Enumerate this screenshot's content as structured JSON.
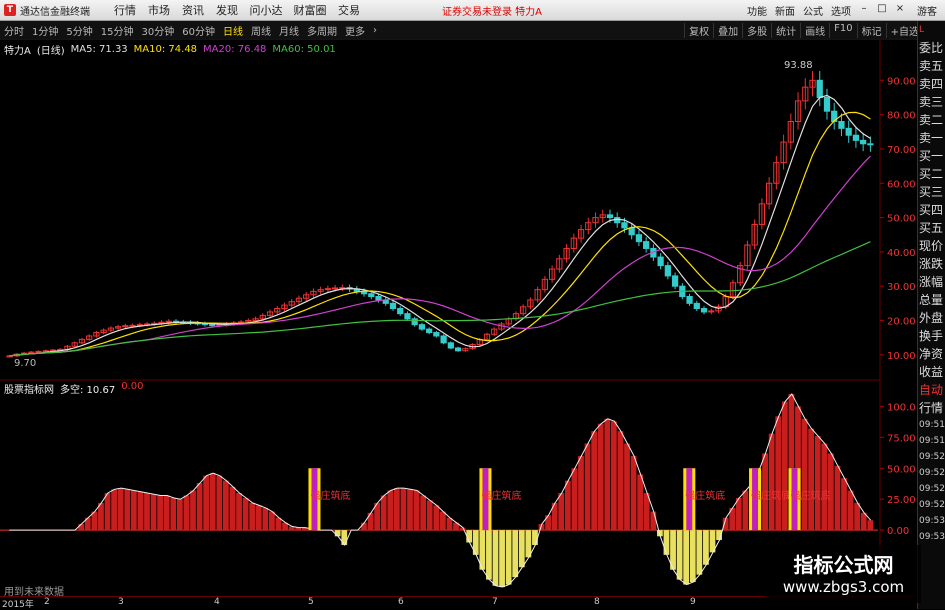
{
  "menubar": {
    "app_title": "通达信金融终端",
    "items": [
      "行情",
      "市场",
      "资讯",
      "发现",
      "问小达",
      "财富圈",
      "交易"
    ],
    "alert": "证券交易未登录 特力A",
    "right_items": [
      "功能",
      "新面",
      "公式",
      "选项"
    ],
    "guest": "游客"
  },
  "period_bar": {
    "periods": [
      "分时",
      "1分钟",
      "5分钟",
      "15分钟",
      "30分钟",
      "60分钟",
      "日线",
      "周线",
      "月线",
      "多周期",
      "更多"
    ],
    "active": "日线",
    "right_tools": [
      "复权",
      "叠加",
      "多股",
      "统计",
      "画线",
      "F10",
      "标记",
      "+自选"
    ]
  },
  "legend": {
    "name": "特力A",
    "period": "(日线)",
    "ma": [
      {
        "label": "MA5: 71.33",
        "color": "#e0e0e0"
      },
      {
        "label": "MA10: 74.48",
        "color": "#ffe100"
      },
      {
        "label": "MA20: 76.48",
        "color": "#d040d0"
      },
      {
        "label": "MA60: 50.01",
        "color": "#40c040"
      }
    ]
  },
  "price_axis": [
    "90.00",
    "80.00",
    "70.00",
    "60.00",
    "50.00",
    "40.00",
    "30.00",
    "20.00",
    "10.00"
  ],
  "price_marks": {
    "high": "93.88",
    "low": "9.70"
  },
  "indicator_legend": {
    "name": "股票指标网",
    "label": "多空: 10.67",
    "value": "0.00"
  },
  "indicator_axis": [
    "100.0",
    "75.00",
    "50.00",
    "25.00",
    "0.00"
  ],
  "signal_text": "强庄筑底",
  "note": "用到未来数据",
  "x_axis": {
    "year": "2015年",
    "labels": [
      "2",
      "3",
      "4",
      "5",
      "6",
      "7",
      "8",
      "9"
    ]
  },
  "sidebar": [
    "委比",
    "卖五",
    "卖四",
    "卖三",
    "卖二",
    "卖一",
    "买一",
    "买二",
    "买三",
    "买四",
    "买五",
    "现价",
    "涨跌",
    "涨幅",
    "总量",
    "外盘",
    "换手",
    "净资",
    "收益"
  ],
  "sidebar_extra": [
    "自动",
    "行情"
  ],
  "sidebar_times": [
    "09:51",
    "09:51",
    "09:52",
    "09:52",
    "09:52",
    "09:52",
    "09:53",
    "09:53"
  ],
  "watermark": {
    "title": "指标公式网",
    "url": "www.zbgs3.com"
  },
  "chart_data": [
    {
      "type": "candlestick",
      "title": "特力A (日线)",
      "ylim": [
        5,
        100
      ],
      "close": [
        9.7,
        10.2,
        10.5,
        10.8,
        11,
        11.2,
        11.4,
        11.6,
        12.5,
        13.5,
        14.5,
        15.5,
        16.5,
        17.2,
        17.8,
        18.2,
        18.5,
        18.6,
        18.8,
        19,
        19.2,
        19.5,
        19.8,
        19.6,
        19.5,
        19.3,
        19.1,
        18.8,
        18.6,
        18.8,
        19,
        19.3,
        19.6,
        20,
        20.5,
        21.5,
        22.5,
        23.5,
        24.5,
        25.5,
        26.5,
        27.5,
        28.5,
        29,
        29.3,
        29.5,
        29.6,
        29.2,
        28.5,
        27.8,
        27,
        26,
        25,
        23.5,
        22,
        20.5,
        18.8,
        17.5,
        16.5,
        15.5,
        13.5,
        12,
        11.2,
        11.8,
        13,
        14.5,
        16,
        17.5,
        19,
        20.5,
        22,
        24,
        26,
        29,
        32,
        35,
        38,
        41,
        44,
        46.5,
        48.5,
        50,
        50.8,
        50,
        48.5,
        47,
        45,
        43,
        41,
        38.5,
        36,
        33,
        30,
        27,
        25,
        23.5,
        22.5,
        22.8,
        24,
        27,
        31,
        36,
        42,
        48,
        54,
        60,
        66,
        72,
        78,
        84,
        88,
        90,
        85,
        81,
        78,
        76,
        74,
        72.5,
        71.5,
        71.3
      ],
      "ma60_end": 50.01
    },
    {
      "type": "bar",
      "title": "多空",
      "ylim": [
        -50,
        110
      ],
      "values": [
        0,
        0,
        0,
        0,
        0,
        0,
        0,
        0,
        0,
        0,
        0,
        5,
        10,
        15,
        22,
        30,
        33,
        34,
        33,
        32,
        31,
        30,
        29,
        28,
        28,
        26,
        25,
        28,
        32,
        38,
        44,
        46,
        44,
        40,
        35,
        30,
        26,
        22,
        20,
        18,
        15,
        10,
        6,
        3,
        2,
        2,
        1,
        0,
        0,
        0,
        -5,
        -12,
        0,
        0,
        6,
        14,
        22,
        28,
        32,
        34,
        34,
        33,
        32,
        28,
        24,
        20,
        15,
        10,
        6,
        2,
        -10,
        -20,
        -32,
        -40,
        -45,
        -46,
        -44,
        -38,
        -30,
        -22,
        -12,
        5,
        12,
        22,
        30,
        40,
        50,
        60,
        70,
        80,
        86,
        90,
        88,
        80,
        70,
        60,
        45,
        30,
        15,
        -5,
        -20,
        -32,
        -40,
        -44,
        -42,
        -36,
        -28,
        -18,
        -8,
        10,
        18,
        26,
        32,
        38,
        48,
        62,
        78,
        92,
        104,
        110,
        100,
        90,
        82,
        76,
        70,
        62,
        52,
        42,
        32,
        22,
        14,
        8
      ],
      "signals": [
        "强庄筑底",
        "强庄筑底",
        "强庄筑底",
        "强庄筑底",
        "强庄筑底",
        "强庄筑底"
      ]
    }
  ]
}
